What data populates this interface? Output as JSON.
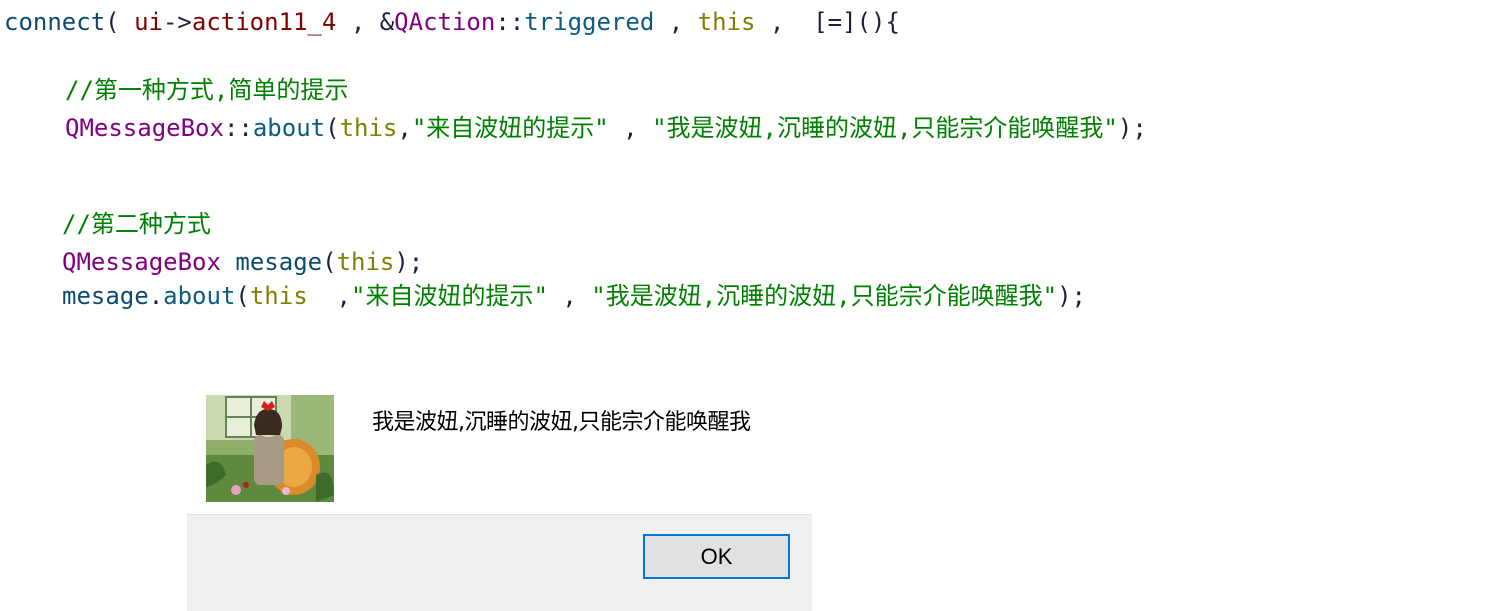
{
  "colors": {
    "default": "#1f1f3f",
    "identifier": "#0e4a6e",
    "type": "#800080",
    "method": "#0e5a80",
    "keyword": "#808000",
    "string": "#008000",
    "comment": "#008000",
    "member": "#800000"
  },
  "code_lines": [
    {
      "name": "code-line-1",
      "tokens": [
        {
          "t": "connect",
          "c": "identifier"
        },
        {
          "t": "( ",
          "c": "default"
        },
        {
          "t": "ui",
          "c": "member"
        },
        {
          "t": "->",
          "c": "default"
        },
        {
          "t": "action11_4",
          "c": "member"
        },
        {
          "t": " , &",
          "c": "default"
        },
        {
          "t": "QAction",
          "c": "type"
        },
        {
          "t": "::",
          "c": "default"
        },
        {
          "t": "triggered",
          "c": "method"
        },
        {
          "t": " , ",
          "c": "default"
        },
        {
          "t": "this",
          "c": "keyword"
        },
        {
          "t": " ,  [=](){",
          "c": "default"
        }
      ]
    },
    {
      "name": "code-line-3",
      "tokens": [
        {
          "t": "//第一种方式,简单的提示",
          "c": "comment"
        }
      ]
    },
    {
      "name": "code-line-4",
      "tokens": [
        {
          "t": "QMessageBox",
          "c": "type"
        },
        {
          "t": "::",
          "c": "default"
        },
        {
          "t": "about",
          "c": "method"
        },
        {
          "t": "(",
          "c": "default"
        },
        {
          "t": "this",
          "c": "keyword"
        },
        {
          "t": ",",
          "c": "default"
        },
        {
          "t": "\"来自波妞的提示\"",
          "c": "string"
        },
        {
          "t": " , ",
          "c": "default"
        },
        {
          "t": "\"我是波妞,沉睡的波妞,只能宗介能唤醒我\"",
          "c": "string"
        },
        {
          "t": ");",
          "c": "default"
        }
      ]
    },
    {
      "name": "code-line-6",
      "tokens": [
        {
          "t": "//第二种方式",
          "c": "comment"
        }
      ]
    },
    {
      "name": "code-line-7",
      "tokens": [
        {
          "t": "QMessageBox",
          "c": "type"
        },
        {
          "t": " ",
          "c": "default"
        },
        {
          "t": "mesage",
          "c": "identifier"
        },
        {
          "t": "(",
          "c": "default"
        },
        {
          "t": "this",
          "c": "keyword"
        },
        {
          "t": ");",
          "c": "default"
        }
      ]
    },
    {
      "name": "code-line-8",
      "tokens": [
        {
          "t": "mesage",
          "c": "identifier"
        },
        {
          "t": ".",
          "c": "default"
        },
        {
          "t": "about",
          "c": "method"
        },
        {
          "t": "(",
          "c": "default"
        },
        {
          "t": "this",
          "c": "keyword"
        },
        {
          "t": "  ,",
          "c": "default"
        },
        {
          "t": "\"来自波妞的提示\"",
          "c": "string"
        },
        {
          "t": " , ",
          "c": "default"
        },
        {
          "t": "\"我是波妞,沉睡的波妞,只能宗介能唤醒我\"",
          "c": "string"
        },
        {
          "t": ");",
          "c": "default"
        }
      ]
    }
  ],
  "dialog": {
    "message": "我是波妞,沉睡的波妞,只能宗介能唤醒我",
    "ok_label": "OK",
    "image_icon": "anime-girl-illustration"
  }
}
